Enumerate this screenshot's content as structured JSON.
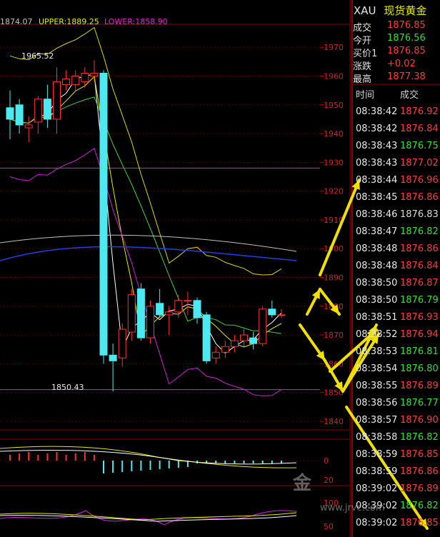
{
  "header": {
    "value_text": "1874.07",
    "upper_text": "UPPER:1889.25",
    "lower_text": "LOWER:1858.90"
  },
  "panel": {
    "symbol": "XAU",
    "name": "现货黄金",
    "rows": [
      {
        "label": "成交",
        "value": "1876.85",
        "color": "#ff3a3a"
      },
      {
        "label": "今开",
        "value": "1876.56",
        "color": "#30e030"
      },
      {
        "label": "买价1",
        "value": "1876.85",
        "color": "#ff3a3a"
      },
      {
        "label": "涨跌",
        "value": "+0.02",
        "color": "#ff3a3a"
      },
      {
        "label": "最高",
        "value": "1877.38",
        "color": "#ff3a3a"
      }
    ],
    "col_time": "时间",
    "col_price": "成交",
    "ticks": [
      {
        "time": "08:38:42",
        "price": "1876.92",
        "color": "#ff3a3a"
      },
      {
        "time": "08:38:42",
        "price": "1876.84",
        "color": "#ff3a3a"
      },
      {
        "time": "08:38:43",
        "price": "1876.75",
        "color": "#30e030"
      },
      {
        "time": "08:38:43",
        "price": "1877.02",
        "color": "#ff3a3a"
      },
      {
        "time": "08:38:44",
        "price": "1876.96",
        "color": "#ff3a3a"
      },
      {
        "time": "08:38:45",
        "price": "1876.86",
        "color": "#ff3a3a"
      },
      {
        "time": "08:38:46",
        "price": "1876.83",
        "color": "#d8d8d8"
      },
      {
        "time": "08:38:47",
        "price": "1876.82",
        "color": "#30e030"
      },
      {
        "time": "08:38:48",
        "price": "1876.86",
        "color": "#ff3a3a"
      },
      {
        "time": "08:38:48",
        "price": "1876.84",
        "color": "#ff3a3a"
      },
      {
        "time": "08:38:50",
        "price": "1876.87",
        "color": "#ff3a3a"
      },
      {
        "time": "08:38:50",
        "price": "1876.79",
        "color": "#30e030"
      },
      {
        "time": "08:38:51",
        "price": "1876.93",
        "color": "#ff3a3a"
      },
      {
        "time": "08:38:52",
        "price": "1876.94",
        "color": "#ff3a3a"
      },
      {
        "time": "08:38:53",
        "price": "1876.81",
        "color": "#30e030"
      },
      {
        "time": "08:38:54",
        "price": "1876.80",
        "color": "#30e030"
      },
      {
        "time": "08:38:55",
        "price": "1876.89",
        "color": "#ff3a3a"
      },
      {
        "time": "08:38:56",
        "price": "1876.77",
        "color": "#30e030"
      },
      {
        "time": "08:38:57",
        "price": "1876.90",
        "color": "#ff3a3a"
      },
      {
        "time": "08:38:58",
        "price": "1876.82",
        "color": "#30e030"
      },
      {
        "time": "08:38:59",
        "price": "1876.85",
        "color": "#ff3a3a"
      },
      {
        "time": "08:38:59",
        "price": "1876.86",
        "color": "#ff3a3a"
      },
      {
        "time": "08:39:02",
        "price": "1876.89",
        "color": "#ff3a3a"
      },
      {
        "time": "08:39:02",
        "price": "1876.82",
        "color": "#30e030"
      },
      {
        "time": "08:39:02",
        "price": "1876.85",
        "color": "#ff3a3a"
      }
    ]
  },
  "watermark": {
    "brand": "金",
    "url": "www.jrvc.com"
  },
  "chart_data": {
    "type": "candlestick",
    "ylim": [
      1838,
      1978
    ],
    "yticks": [
      1840,
      1850,
      1860,
      1870,
      1880,
      1890,
      1900,
      1910,
      1920,
      1930,
      1940,
      1950,
      1960,
      1970
    ],
    "colors": {
      "up": "#ff3030",
      "down": "#4ee8f0",
      "upper_band": "#e8e800",
      "lower_band": "#e020e0"
    },
    "annotations": [
      {
        "text": "1965.52",
        "value": 1965.52
      },
      {
        "text": "1850.43",
        "value": 1850.43
      }
    ],
    "candles": [
      {
        "o": 1949,
        "h": 1955,
        "l": 1938,
        "c": 1945
      },
      {
        "o": 1950,
        "h": 1952,
        "l": 1940,
        "c": 1943
      },
      {
        "o": 1942,
        "h": 1946,
        "l": 1937,
        "c": 1943
      },
      {
        "o": 1944,
        "h": 1953,
        "l": 1940,
        "c": 1952
      },
      {
        "o": 1952,
        "h": 1957,
        "l": 1942,
        "c": 1945
      },
      {
        "o": 1945,
        "h": 1963,
        "l": 1940,
        "c": 1958
      },
      {
        "o": 1957,
        "h": 1962,
        "l": 1955,
        "c": 1959
      },
      {
        "o": 1957,
        "h": 1962,
        "l": 1955,
        "c": 1960
      },
      {
        "o": 1958,
        "h": 1963,
        "l": 1956,
        "c": 1961
      },
      {
        "o": 1960,
        "h": 1965.5,
        "l": 1958,
        "c": 1961
      },
      {
        "o": 1961,
        "h": 1962,
        "l": 1860,
        "c": 1863
      },
      {
        "o": 1863,
        "h": 1867,
        "l": 1850.4,
        "c": 1861
      },
      {
        "o": 1862,
        "h": 1874,
        "l": 1859,
        "c": 1872
      },
      {
        "o": 1871,
        "h": 1886,
        "l": 1868,
        "c": 1884
      },
      {
        "o": 1886,
        "h": 1888,
        "l": 1868,
        "c": 1869
      },
      {
        "o": 1869,
        "h": 1882,
        "l": 1867,
        "c": 1880
      },
      {
        "o": 1881,
        "h": 1886,
        "l": 1876,
        "c": 1877
      },
      {
        "o": 1877,
        "h": 1880,
        "l": 1870,
        "c": 1878
      },
      {
        "o": 1878,
        "h": 1884,
        "l": 1876,
        "c": 1882
      },
      {
        "o": 1882,
        "h": 1885,
        "l": 1877,
        "c": 1882
      },
      {
        "o": 1882,
        "h": 1883,
        "l": 1874,
        "c": 1876
      },
      {
        "o": 1877,
        "h": 1878,
        "l": 1860,
        "c": 1861
      },
      {
        "o": 1862,
        "h": 1866,
        "l": 1860,
        "c": 1864
      },
      {
        "o": 1864,
        "h": 1868,
        "l": 1862,
        "c": 1866
      },
      {
        "o": 1866,
        "h": 1870,
        "l": 1864,
        "c": 1868
      },
      {
        "o": 1868,
        "h": 1872,
        "l": 1866,
        "c": 1870
      },
      {
        "o": 1869,
        "h": 1871,
        "l": 1865,
        "c": 1867
      },
      {
        "o": 1867,
        "h": 1880,
        "l": 1866,
        "c": 1879
      },
      {
        "o": 1879,
        "h": 1882,
        "l": 1876,
        "c": 1877
      },
      {
        "o": 1877,
        "h": 1879,
        "l": 1876,
        "c": 1877
      }
    ],
    "horizontal_lines": [
      1928,
      1851
    ]
  }
}
